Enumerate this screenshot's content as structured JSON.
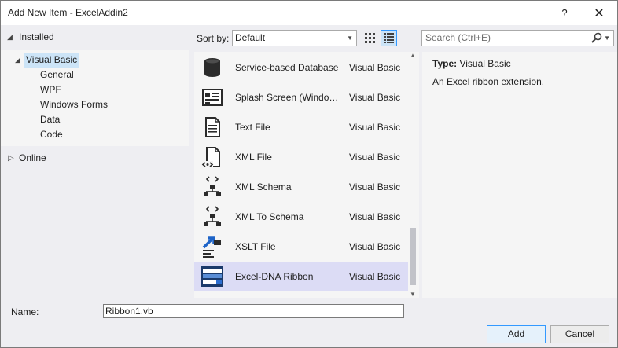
{
  "window": {
    "title": "Add New Item - ExcelAddin2",
    "help_glyph": "?",
    "close_glyph": "✕"
  },
  "tree": {
    "installed": "Installed",
    "visual_basic": "Visual Basic",
    "children": [
      "General",
      "WPF",
      "Windows Forms",
      "Data",
      "Code"
    ],
    "online": "Online"
  },
  "toolbar": {
    "sort_label": "Sort by:",
    "sort_value": "Default",
    "search_placeholder": "Search (Ctrl+E)"
  },
  "items": [
    {
      "name": "Service-based Database",
      "lang": "Visual Basic",
      "icon": "database-icon"
    },
    {
      "name": "Splash Screen (Windows Forms)",
      "lang": "Visual Basic",
      "icon": "splash-screen-icon"
    },
    {
      "name": "Text File",
      "lang": "Visual Basic",
      "icon": "text-file-icon"
    },
    {
      "name": "XML File",
      "lang": "Visual Basic",
      "icon": "xml-file-icon"
    },
    {
      "name": "XML Schema",
      "lang": "Visual Basic",
      "icon": "xml-schema-icon"
    },
    {
      "name": "XML To Schema",
      "lang": "Visual Basic",
      "icon": "xml-to-schema-icon"
    },
    {
      "name": "XSLT File",
      "lang": "Visual Basic",
      "icon": "xslt-file-icon"
    },
    {
      "name": "Excel-DNA Ribbon",
      "lang": "Visual Basic",
      "icon": "excel-dna-ribbon-icon",
      "selected": true
    }
  ],
  "details": {
    "type_label": "Type:",
    "type_value": "Visual Basic",
    "description": "An Excel ribbon extension."
  },
  "bottom": {
    "name_label": "Name:",
    "name_value": "Ribbon1.vb",
    "add_label": "Add",
    "cancel_label": "Cancel"
  },
  "colors": {
    "selection": "#cce4f7",
    "list_selection": "#dcdcf5",
    "accent": "#3399ff"
  }
}
